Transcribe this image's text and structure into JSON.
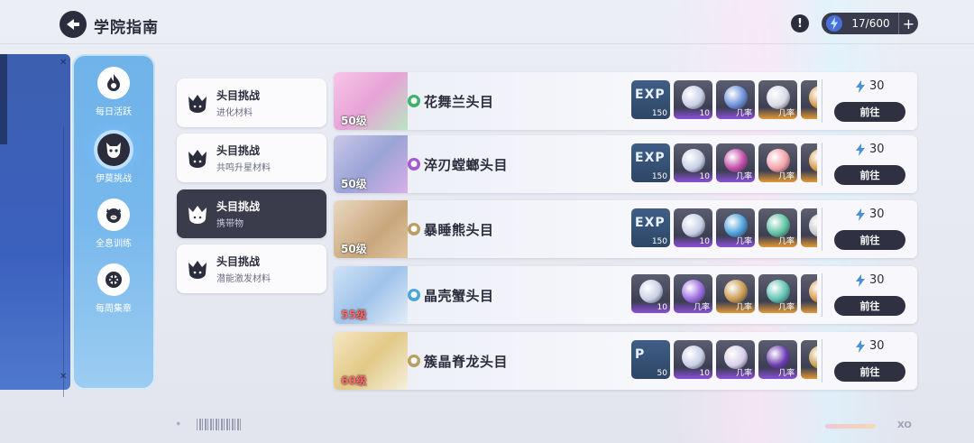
{
  "header": {
    "title": "学院指南",
    "energy": "17/600",
    "plus": "+",
    "info": "!"
  },
  "sidenav": {
    "items": [
      {
        "label": "每日活跃",
        "icon": "flame-icon",
        "active": false
      },
      {
        "label": "伊莫挑战",
        "icon": "monster-face-icon",
        "active": true
      },
      {
        "label": "全息训练",
        "icon": "pig-face-icon",
        "active": false
      },
      {
        "label": "每周集章",
        "icon": "emblem-icon",
        "active": false
      }
    ]
  },
  "categories": [
    {
      "name": "头目挑战",
      "sub": "进化材料",
      "active": false
    },
    {
      "name": "头目挑战",
      "sub": "共鸣升星材料",
      "active": false
    },
    {
      "name": "头目挑战",
      "sub": "携带物",
      "active": true
    },
    {
      "name": "头目挑战",
      "sub": "潜能激发材料",
      "active": false
    }
  ],
  "rows": [
    {
      "level": "50级",
      "name": "花舞兰头目",
      "element_color": "#3fb36b",
      "cost": "30",
      "go": "前往",
      "items": [
        {
          "type": "exp",
          "label": "EXP",
          "count": "150"
        },
        {
          "type": "purple",
          "count": "10",
          "color": "#c8d0e6"
        },
        {
          "type": "purple",
          "rate": "几率",
          "color": "#6a8ed8"
        },
        {
          "type": "gold",
          "rate": "几率",
          "color": "#d8dbe6"
        },
        {
          "type": "gold",
          "rate": "",
          "color": "#d89a4a"
        }
      ]
    },
    {
      "level": "50级",
      "name": "淬刃螳螂头目",
      "element_color": "#a35bd6",
      "cost": "30",
      "go": "前往",
      "items": [
        {
          "type": "exp",
          "label": "EXP",
          "count": "150"
        },
        {
          "type": "purple",
          "count": "10",
          "color": "#c8d0e6"
        },
        {
          "type": "purple",
          "rate": "几率",
          "color": "#c04aa6"
        },
        {
          "type": "gold",
          "rate": "几率",
          "color": "#f2a0a8"
        },
        {
          "type": "gold",
          "rate": "",
          "color": "#d89a4a"
        }
      ]
    },
    {
      "level": "50级",
      "name": "暴睡熊头目",
      "element_color": "#b8a060",
      "cost": "30",
      "go": "前往",
      "items": [
        {
          "type": "exp",
          "label": "EXP",
          "count": "150"
        },
        {
          "type": "purple",
          "count": "10",
          "color": "#c8d0e6"
        },
        {
          "type": "purple",
          "rate": "几率",
          "color": "#4a9ed8"
        },
        {
          "type": "gold",
          "rate": "几率",
          "color": "#5cc0a0"
        },
        {
          "type": "gold",
          "rate": "",
          "color": "#c8c8c8"
        }
      ]
    },
    {
      "level": "55级",
      "name": "晶壳蟹头目",
      "element_color": "#4aa8d8",
      "cost": "30",
      "go": "前往",
      "items": [
        {
          "type": "purple",
          "count": "10",
          "color": "#c8d0e6"
        },
        {
          "type": "purple",
          "rate": "几率",
          "color": "#9a6ae0"
        },
        {
          "type": "gold",
          "rate": "几率",
          "color": "#c89a50"
        },
        {
          "type": "gold",
          "rate": "几率",
          "color": "#5cc0b0"
        },
        {
          "type": "gold",
          "rate": "",
          "color": "#d89a4a"
        }
      ]
    },
    {
      "level": "60级",
      "name": "簇晶脊龙头目",
      "element_color": "#b8a060",
      "cost": "30",
      "go": "前往",
      "items": [
        {
          "type": "exp",
          "label": "P",
          "count": "50"
        },
        {
          "type": "purple",
          "count": "10",
          "color": "#c8d0e6"
        },
        {
          "type": "purple",
          "rate": "几率",
          "color": "#d8d0e8"
        },
        {
          "type": "purple",
          "rate": "几率",
          "color": "#6a3ab0"
        },
        {
          "type": "gold",
          "rate": "几率",
          "color": "#c8a050"
        }
      ]
    }
  ],
  "footer": {
    "mark": "XO"
  }
}
